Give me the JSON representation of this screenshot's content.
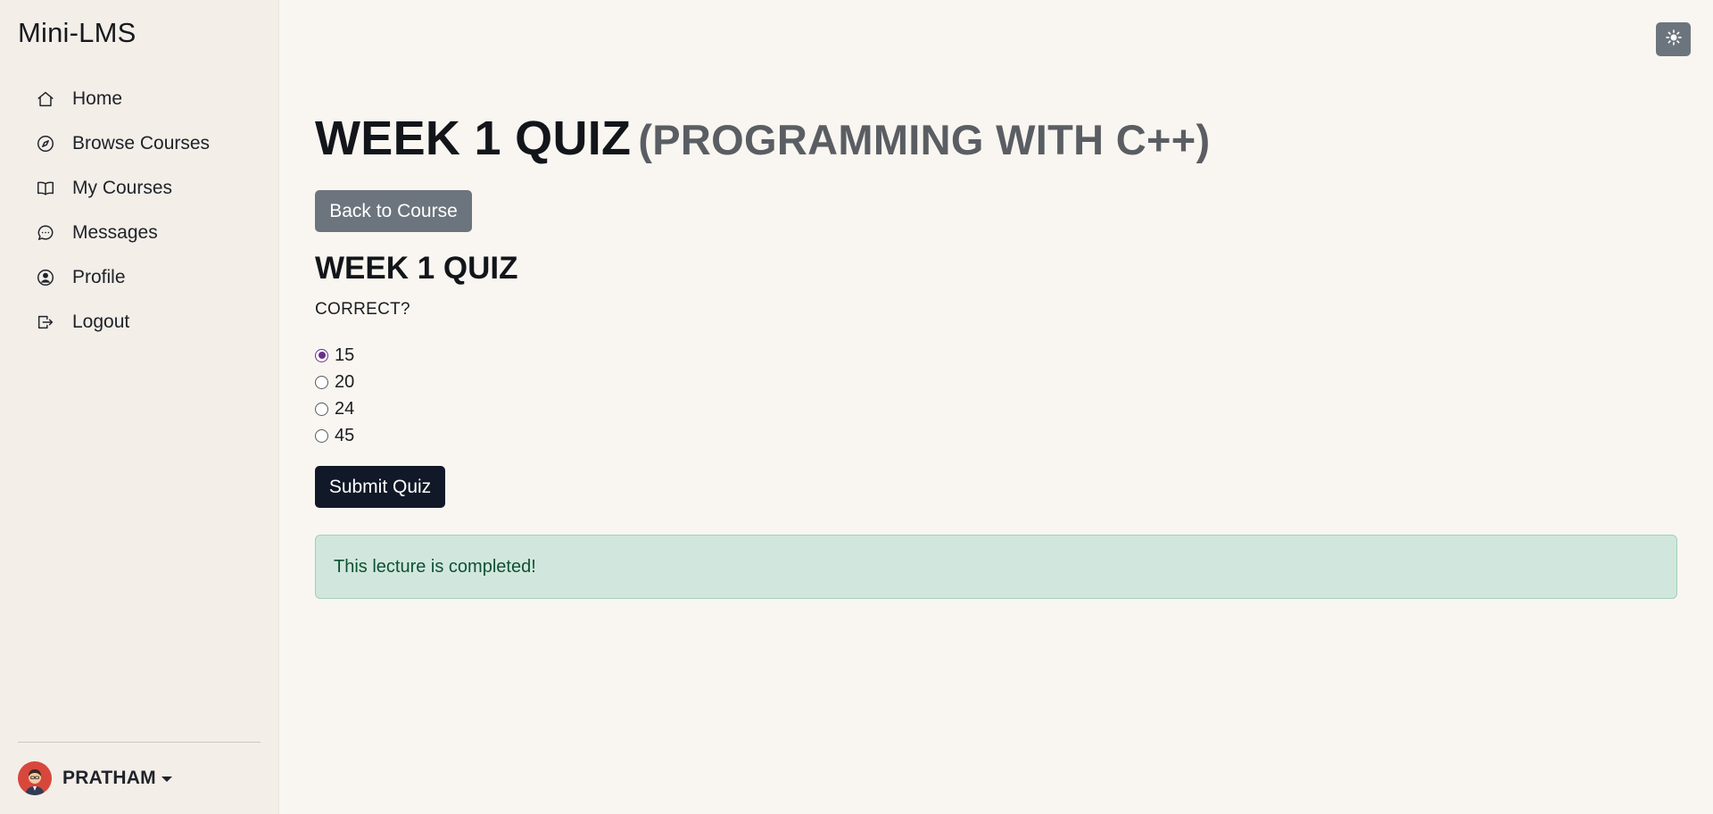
{
  "app": {
    "brand": "Mini-LMS"
  },
  "sidebar": {
    "items": [
      {
        "label": "Home",
        "icon": "house-icon"
      },
      {
        "label": "Browse Courses",
        "icon": "compass-icon"
      },
      {
        "label": "My Courses",
        "icon": "book-icon"
      },
      {
        "label": "Messages",
        "icon": "chat-dots-icon"
      },
      {
        "label": "Profile",
        "icon": "person-circle-icon"
      },
      {
        "label": "Logout",
        "icon": "box-arrow-right-icon"
      }
    ],
    "user": {
      "name": "PRATHAM",
      "avatar_color": "#d8473b"
    }
  },
  "header": {
    "theme_toggle_icon": "sun-icon"
  },
  "main": {
    "title": "WEEK 1 QUIZ",
    "subtitle": "(PROGRAMMING WITH C++)",
    "back_button": "Back to Course",
    "quiz_title": "WEEK 1 QUIZ",
    "question": "CORRECT?",
    "options": [
      {
        "label": "15",
        "selected": true
      },
      {
        "label": "20",
        "selected": false
      },
      {
        "label": "24",
        "selected": false
      },
      {
        "label": "45",
        "selected": false
      }
    ],
    "submit_button": "Submit Quiz",
    "alert": "This lecture is completed!"
  },
  "colors": {
    "accent_dark": "#111827",
    "secondary": "#6c757d",
    "success_bg": "#d1e7dd",
    "success_text": "#0f5132",
    "radio_selected": "#6a2f8a"
  }
}
